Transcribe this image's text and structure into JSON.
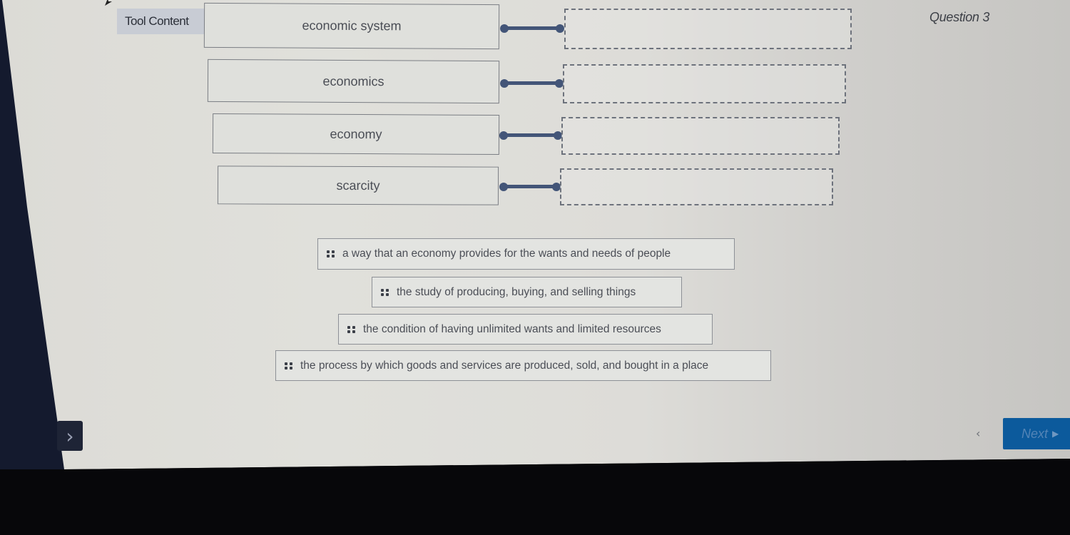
{
  "header": {
    "tool_content_label": "Tool Content",
    "question_label": "Question 3"
  },
  "terms": [
    {
      "label": "economic system"
    },
    {
      "label": "economics"
    },
    {
      "label": "economy"
    },
    {
      "label": "scarcity"
    }
  ],
  "drop_zones": [
    {
      "value": ""
    },
    {
      "value": ""
    },
    {
      "value": ""
    },
    {
      "value": ""
    }
  ],
  "answer_tiles": [
    {
      "label": "a way that an economy provides for the wants and needs of people",
      "icon": "drag-handle-icon"
    },
    {
      "label": "the study of producing, buying, and selling things",
      "icon": "drag-handle-icon"
    },
    {
      "label": "the condition of having unlimited wants and limited resources",
      "icon": "drag-handle-icon"
    },
    {
      "label": "the process by which goods and services are produced, sold, and bought in a place",
      "icon": "drag-handle-icon"
    }
  ],
  "navigation": {
    "next_label": "Next",
    "next_icon": "▶",
    "prev_icon": "‹",
    "sidebar_toggle_icon": "›"
  },
  "colors": {
    "connector": "#435578",
    "next_button": "#0c5a9c",
    "tool_content_bg": "#c8ccd4"
  }
}
